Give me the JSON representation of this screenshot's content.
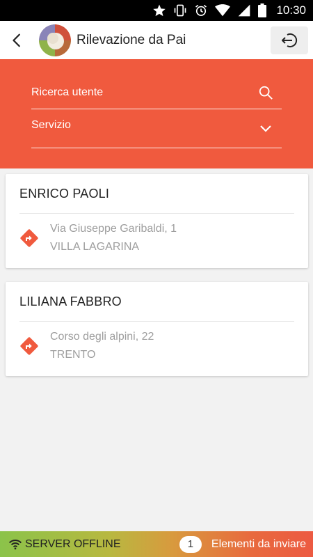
{
  "status_bar": {
    "time": "10:30",
    "icons": [
      "star-icon",
      "vibrate-icon",
      "alarm-icon",
      "wifi-icon",
      "no-sim-icon",
      "battery-icon"
    ]
  },
  "app_bar": {
    "title": "Rilevazione da Pai",
    "back_icon": "arrow-back-icon",
    "logout_icon": "logout-icon"
  },
  "filters": {
    "search_placeholder": "Ricerca utente",
    "search_value": "",
    "service_label": "Servizio"
  },
  "users": [
    {
      "name": "ENRICO PAOLI",
      "street": "Via Giuseppe Garibaldi, 1",
      "city": "VILLA LAGARINA"
    },
    {
      "name": "LILIANA FABBRO",
      "street": "Corso degli alpini, 22",
      "city": "TRENTO"
    }
  ],
  "footer": {
    "server_status": "SERVER OFFLINE",
    "pending_count": "1",
    "pending_label": "Elementi da inviare"
  },
  "colors": {
    "accent": "#f05a3e",
    "direction_icon": "#f05a3e",
    "status_bar": "#000000"
  }
}
